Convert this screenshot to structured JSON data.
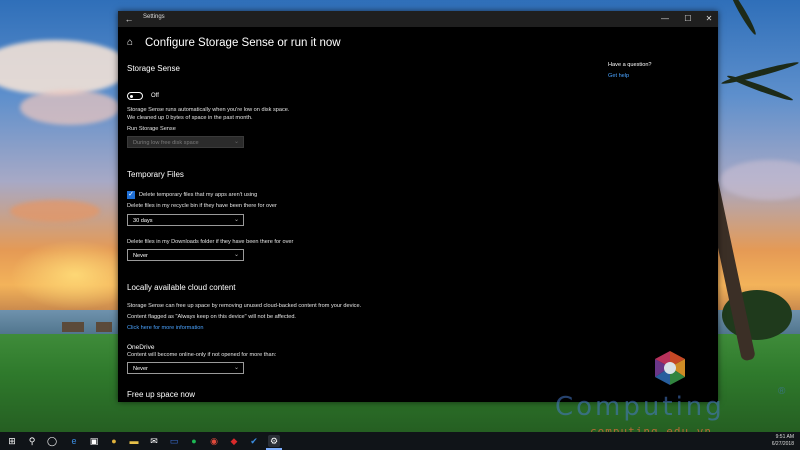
{
  "window": {
    "app_title": "Settings",
    "back_glyph": "←",
    "minimize_glyph": "—",
    "maximize_glyph": "☐",
    "close_glyph": "✕",
    "home_glyph": "⌂"
  },
  "page": {
    "title": "Configure Storage Sense or run it now"
  },
  "help": {
    "heading": "Have a question?",
    "link": "Get help"
  },
  "storage_sense": {
    "heading": "Storage Sense",
    "toggle_state": "Off",
    "description_line1": "Storage Sense runs automatically when you're low on disk space.",
    "description_line2": "We cleaned up 0 bytes of space in the past month.",
    "run_label": "Run Storage Sense",
    "run_value": "During low free disk space"
  },
  "temporary_files": {
    "heading": "Temporary Files",
    "checkbox_label": "Delete temporary files that my apps aren't using",
    "checkbox_checked": true,
    "recycle_label": "Delete files in my recycle bin if they have been there for over",
    "recycle_value": "30 days",
    "downloads_label": "Delete files in my Downloads folder if they have been there for over",
    "downloads_value": "Never"
  },
  "cloud_content": {
    "heading": "Locally available cloud content",
    "description_line1": "Storage Sense can free up space by removing unused cloud-backed content from your device.",
    "description_line2": "Content flagged as \"Always keep on this device\" will not be affected.",
    "more_info_link": "Click here for more information",
    "onedrive_heading": "OneDrive",
    "onedrive_label": "Content will become online-only if not opened for more than:",
    "onedrive_value": "Never"
  },
  "free_up": {
    "heading": "Free up space now"
  },
  "watermark": {
    "brand": "Computing",
    "registered": "®",
    "url": "computing.edu.vn"
  },
  "taskbar": {
    "items": [
      {
        "name": "start",
        "glyph": "⊞",
        "color": "#ffffff"
      },
      {
        "name": "search",
        "glyph": "⚲",
        "color": "#ffffff"
      },
      {
        "name": "task-view",
        "glyph": "◯",
        "color": "#ffffff"
      },
      {
        "name": "edge",
        "glyph": "e",
        "color": "#3b8de0"
      },
      {
        "name": "store",
        "glyph": "▣",
        "color": "#ffffff"
      },
      {
        "name": "chrome",
        "glyph": "●",
        "color": "#e0b23b"
      },
      {
        "name": "explorer",
        "glyph": "▬",
        "color": "#e8c24a"
      },
      {
        "name": "mail",
        "glyph": "✉",
        "color": "#ffffff"
      },
      {
        "name": "photos",
        "glyph": "▭",
        "color": "#3b6fd6"
      },
      {
        "name": "spotify",
        "glyph": "●",
        "color": "#1db954"
      },
      {
        "name": "groove",
        "glyph": "◉",
        "color": "#e04a3b"
      },
      {
        "name": "acrobat",
        "glyph": "◆",
        "color": "#d92a2a"
      },
      {
        "name": "app-blue",
        "glyph": "✔",
        "color": "#3b8de0"
      },
      {
        "name": "settings",
        "glyph": "⚙",
        "color": "#ffffff"
      }
    ],
    "clock_time": "9:51 AM",
    "clock_date": "6/27/2018"
  },
  "colors": {
    "window_bg": "#000000",
    "accent": "#1f6fd6",
    "link": "#4aa3ff"
  }
}
